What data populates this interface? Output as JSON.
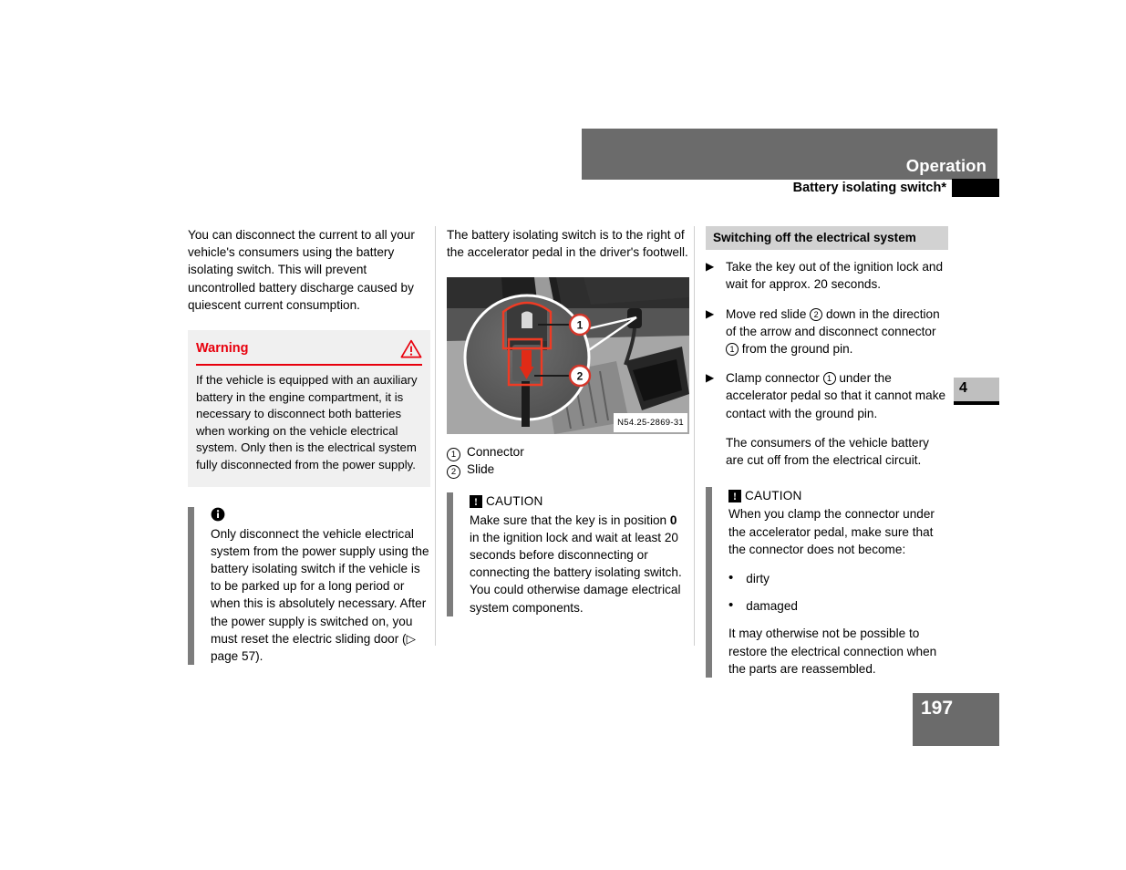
{
  "header": {
    "band_title": "Operation",
    "subtitle": "Battery isolating switch*"
  },
  "chapter_marker": {
    "number": "4"
  },
  "page_footer": {
    "page_number": "197"
  },
  "column_left": {
    "intro": "You can disconnect the current to all your vehicle's consumers using the battery isolating switch. This will prevent uncontrolled battery discharge caused by quiescent current consumption.",
    "warning": {
      "title": "Warning",
      "icon": "warning-triangle-icon",
      "body": "If the vehicle is equipped with an auxiliary battery in the engine compartment, it is necessary to disconnect both batteries when working on the vehicle electrical system. Only then is the electrical system fully disconnected from the power supply.",
      "accent_color": "#e8000d",
      "background_color": "#f0f0f0"
    },
    "note": {
      "icon": "info-icon",
      "body": "Only disconnect the vehicle electrical system from the power supply using the battery isolating switch if the vehicle is to be parked up for a long period or when this is absolutely necessary. After the power supply is switched on, you must reset the electric sliding door (▷ page 57)."
    }
  },
  "column_middle": {
    "intro": "The battery isolating switch is to the right of the accelerator pedal in the driver's footwell.",
    "figure": {
      "code": "N54.25-2869-31",
      "alt": "Battery isolating switch located right of the accelerator pedal in the driver's footwell, with magnified circular callout showing connector and red slide"
    },
    "legend": [
      {
        "num": "1",
        "label": "Connector"
      },
      {
        "num": "2",
        "label": "Slide"
      }
    ],
    "caution": {
      "mark": "!",
      "word": "CAUTION",
      "text_before_bold": "Make sure that the key is in position ",
      "bold": "0",
      "text_after_bold": " in the ignition lock and wait at least 20 seconds before disconnecting or connecting the battery isolating switch. You could otherwise damage electrical system components."
    }
  },
  "column_right": {
    "section_heading": "Switching off the electrical system",
    "steps": [
      {
        "arrow": "▶",
        "parts": [
          {
            "type": "text",
            "value": "Take the key out of the ignition lock and wait for approx. 20 seconds."
          }
        ]
      },
      {
        "arrow": "▶",
        "parts": [
          {
            "type": "text",
            "value": "Move red slide "
          },
          {
            "type": "circnum",
            "value": "2"
          },
          {
            "type": "text",
            "value": " down in the direction of the arrow and disconnect connector "
          },
          {
            "type": "circnum",
            "value": "1"
          },
          {
            "type": "text",
            "value": " from the ground pin."
          }
        ]
      },
      {
        "arrow": "▶",
        "parts": [
          {
            "type": "text",
            "value": "Clamp connector "
          },
          {
            "type": "circnum",
            "value": "1"
          },
          {
            "type": "text",
            "value": " under the accelerator pedal so that it cannot make contact with the ground pin."
          }
        ]
      }
    ],
    "result_text": "The consumers of the vehicle battery are cut off from the electrical circuit.",
    "caution": {
      "mark": "!",
      "word": "CAUTION",
      "intro": "When you clamp the connector under the accelerator pedal, make sure that the connector does not become:",
      "bullets": [
        "dirty",
        "damaged"
      ],
      "closing": "It may otherwise not be possible to restore the electrical connection when the parts are reassembled."
    }
  },
  "colors": {
    "header_band": "#6b6b6b",
    "section_heading": "#d2d2d2",
    "bar": "#7d7d7d",
    "chapter_tab": "#bfbfbf",
    "warning_red": "#e8000d"
  }
}
